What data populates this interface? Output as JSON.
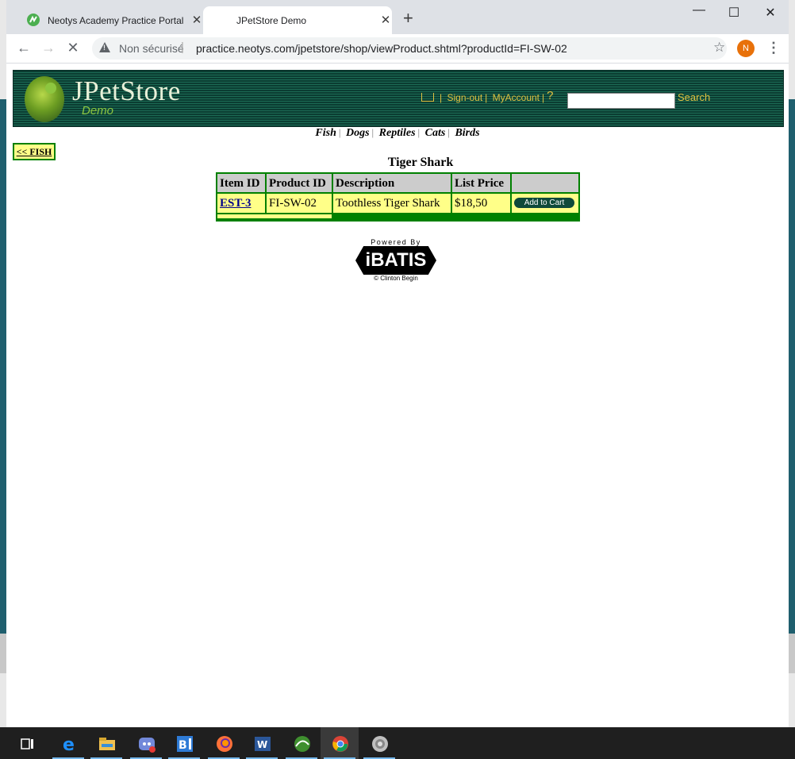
{
  "browser": {
    "tabs": [
      {
        "title": "Neotys Academy Practice Portal",
        "active": false
      },
      {
        "title": "JPetStore Demo",
        "active": true
      }
    ],
    "new_tab_symbol": "+",
    "window_controls": {
      "minimize": "—",
      "maximize": "☐",
      "close": "✕"
    },
    "security_label": "Non sécurisé",
    "url": "practice.neotys.com/jpetstore/shop/viewProduct.shtml?productId=FI-SW-02",
    "profile_initial": "N"
  },
  "header": {
    "logo_title": "JPetStore",
    "logo_subtitle": "Demo",
    "links": {
      "sign_out": "Sign-out",
      "my_account": "MyAccount",
      "help": "?"
    },
    "search": {
      "value": "",
      "button_label": "Search"
    }
  },
  "categories": [
    "Fish",
    "Dogs",
    "Reptiles",
    "Cats",
    "Birds"
  ],
  "back_link": "<< FISH",
  "product": {
    "title": "Tiger Shark",
    "columns": [
      "Item ID",
      "Product ID",
      "Description",
      "List Price",
      ""
    ],
    "items": [
      {
        "item_id": "EST-3",
        "product_id": "FI-SW-02",
        "description": "Toothless Tiger Shark",
        "list_price": "$18,50",
        "action": "Add to Cart"
      }
    ]
  },
  "footer": {
    "powered_by": "Powered By",
    "logo_text": "iBATIS",
    "credit": "© Clinton Begin"
  },
  "taskbar": {
    "items": [
      "task-view-icon",
      "edge-icon",
      "file-explorer-icon",
      "discord-icon",
      "blitz-icon",
      "firefox-icon",
      "word-icon",
      "neoload-icon",
      "chrome-icon",
      "app-icon"
    ],
    "active_item": "chrome-icon"
  },
  "colors": {
    "header_bg": "#0b3d32",
    "header_link": "#e0c040",
    "table_border": "#008000",
    "table_header": "#cccccc",
    "table_cell": "#ffff88",
    "logo_green": "#8dc63f"
  }
}
